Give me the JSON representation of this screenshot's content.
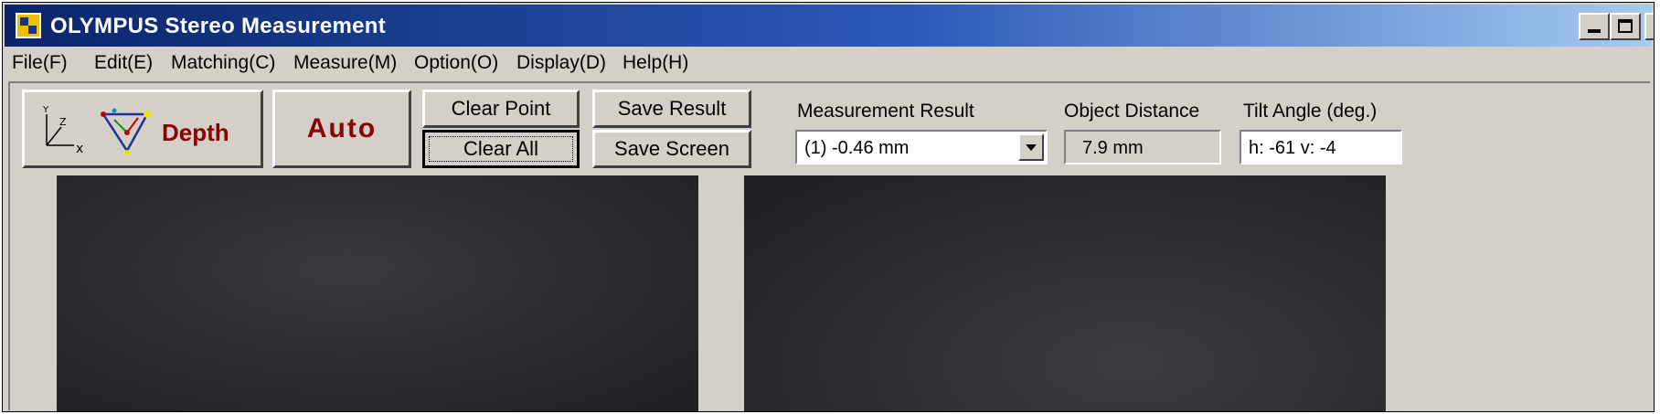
{
  "window": {
    "title": "OLYMPUS Stereo Measurement",
    "controls": {
      "minimize": "minimize-icon",
      "maximize": "maximize-icon",
      "close": "close-icon"
    }
  },
  "menu": [
    {
      "label": "File(F)"
    },
    {
      "label": "Edit(E)"
    },
    {
      "label": "Matching(C)"
    },
    {
      "label": "Measure(M)"
    },
    {
      "label": "Option(O)"
    },
    {
      "label": "Display(D)"
    },
    {
      "label": "Help(H)"
    }
  ],
  "toolbar": {
    "depth_label": "Depth",
    "auto_label": "Auto",
    "clear_point": "Clear Point",
    "clear_all": "Clear All",
    "save_result": "Save Result",
    "save_screen": "Save Screen"
  },
  "measurement": {
    "label": "Measurement Result",
    "value": "(1)  -0.46 mm"
  },
  "object_distance": {
    "label": "Object Distance",
    "value": "7.9 mm"
  },
  "tilt_angle": {
    "label": "Tilt Angle (deg.)",
    "value": "h: -61  v: -4"
  },
  "colors": {
    "title_gradient_start": "#0a246a",
    "title_gradient_end": "#a6caf0",
    "face": "#d4d0c8",
    "accent_red": "#8b0000"
  }
}
